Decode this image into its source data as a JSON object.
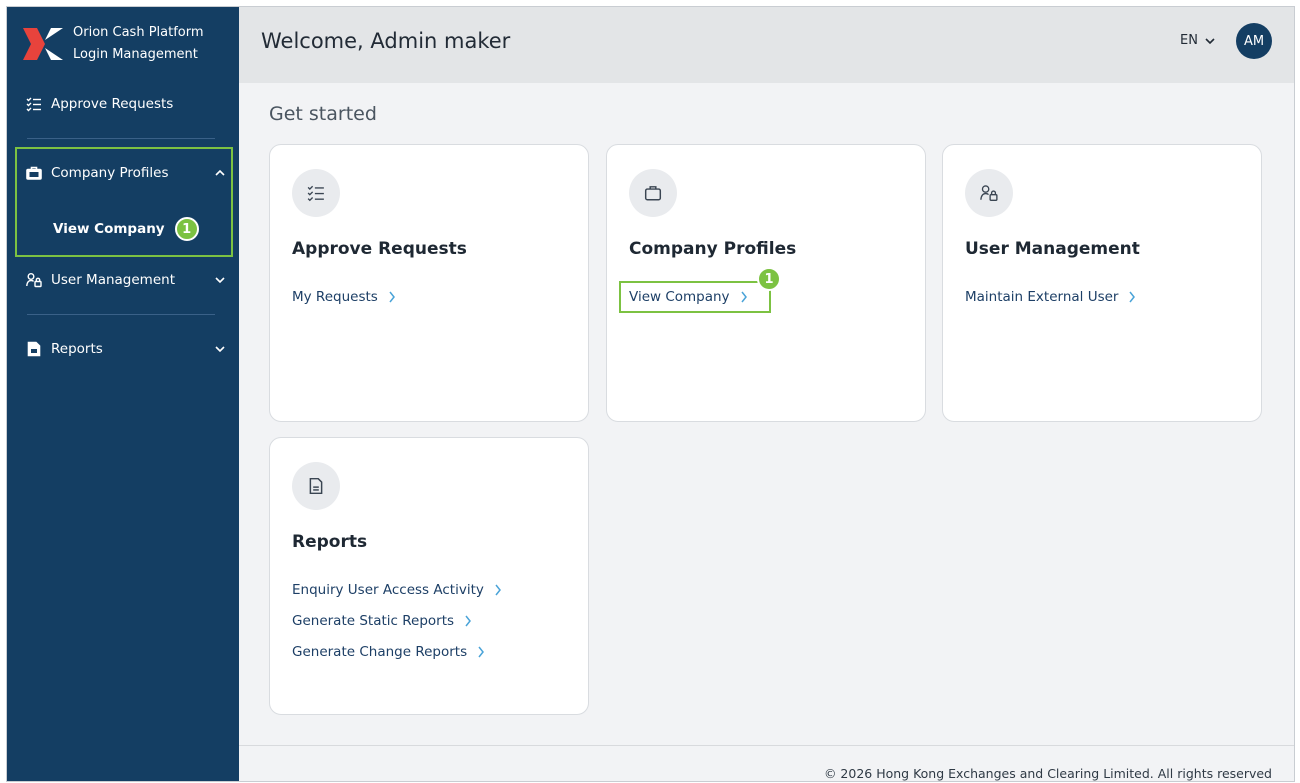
{
  "app": {
    "name_line1": "Orion Cash Platform",
    "name_line2": "Login Management"
  },
  "sidebar": {
    "items": [
      {
        "label": "Approve Requests",
        "icon": "checklist-icon"
      },
      {
        "label": "Company Profiles",
        "icon": "briefcase-icon",
        "expanded": true,
        "children": [
          {
            "label": "View Company",
            "badge": "1"
          }
        ]
      },
      {
        "label": "User Management",
        "icon": "user-lock-icon"
      },
      {
        "label": "Reports",
        "icon": "document-icon"
      }
    ]
  },
  "header": {
    "welcome": "Welcome, Admin maker",
    "language": "EN",
    "avatar_initials": "AM"
  },
  "main": {
    "section_title": "Get started",
    "cards": [
      {
        "title": "Approve Requests",
        "icon": "checklist-icon",
        "links": [
          "My Requests"
        ]
      },
      {
        "title": "Company Profiles",
        "icon": "briefcase-icon",
        "links": [
          "View Company"
        ],
        "badge": "1"
      },
      {
        "title": "User Management",
        "icon": "user-lock-icon",
        "links": [
          "Maintain External User"
        ]
      },
      {
        "title": "Reports",
        "icon": "document-icon",
        "links": [
          "Enquiry User Access Activity",
          "Generate Static Reports",
          "Generate Change Reports"
        ]
      }
    ]
  },
  "footer": {
    "copyright": "© 2026 Hong Kong Exchanges and Clearing Limited. All rights reserved"
  },
  "colors": {
    "sidebar": "#143e63",
    "highlight": "#7cc242",
    "link": "#1d3f66",
    "chevron": "#4aa3d8"
  }
}
